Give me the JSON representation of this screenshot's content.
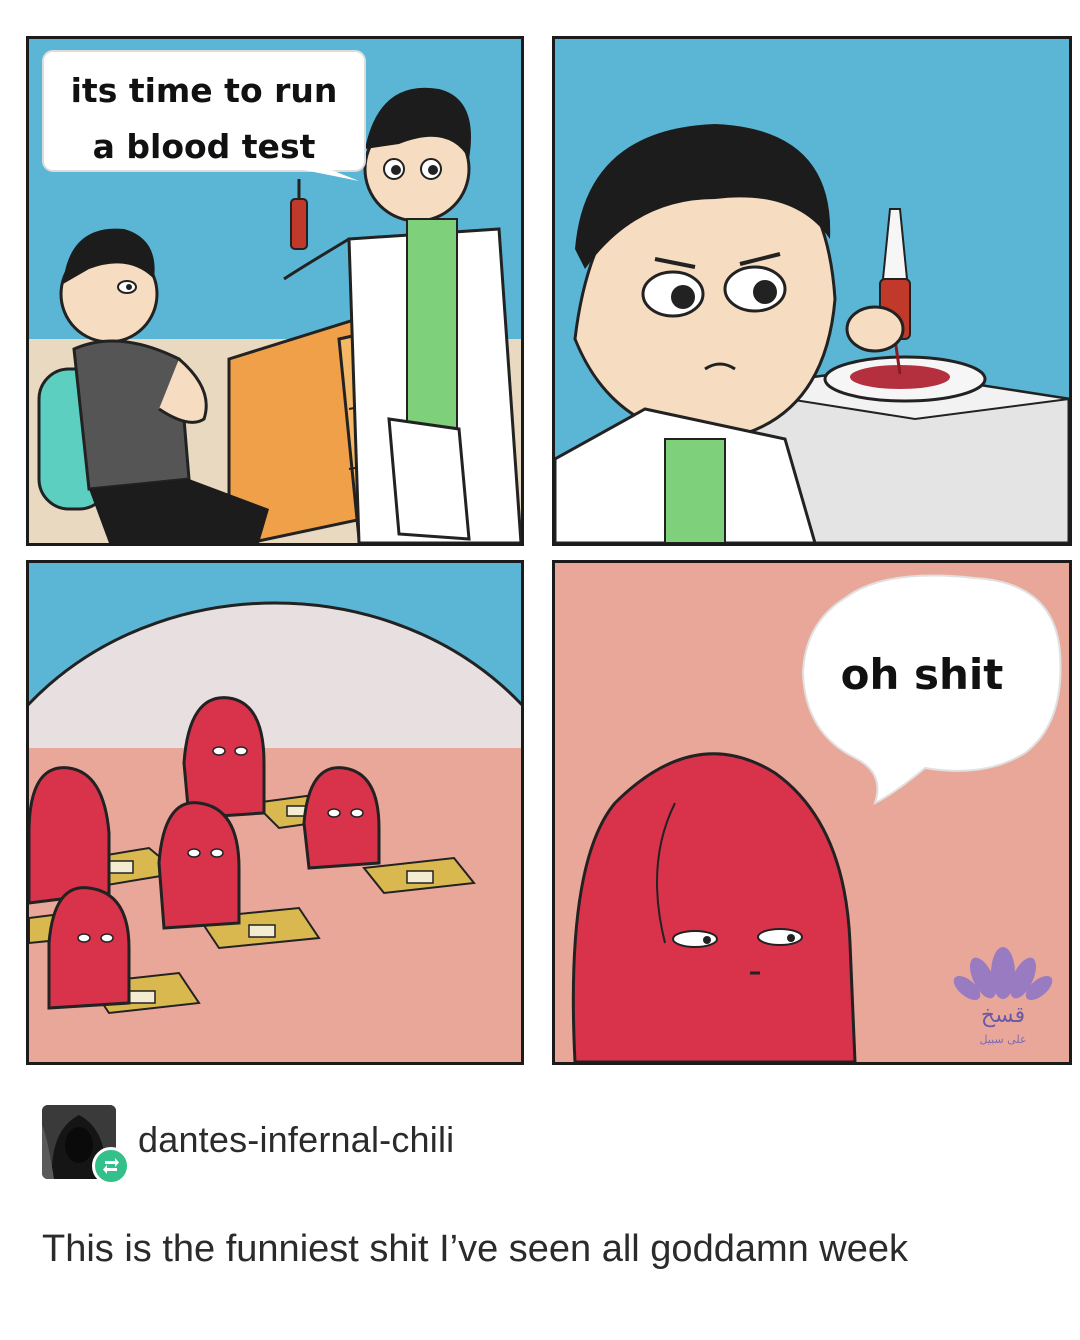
{
  "comic": {
    "panel1": {
      "speech": [
        "its time to run",
        "a blood test"
      ]
    },
    "panel4": {
      "speech": "oh shit"
    },
    "watermark": {
      "main": "قسخ",
      "sub": "ﻋﻠﻰ ﺳﺒﻴﻞ"
    }
  },
  "post": {
    "username": "dantes-infernal-chili",
    "text": "This is the funniest shit I’ve seen all goddamn week",
    "reblog_icon": "reblog-icon",
    "avatar_icon": "avatar-hooded-figure"
  },
  "colors": {
    "sky": "#5bb6d6",
    "blood_cell": "#d8334a",
    "blood_bg": "#e9a79a",
    "cabinet": "#f0a048",
    "lab_coat": "#ffffff",
    "shirt_green": "#7fd07a",
    "reblog_green": "#33c08a"
  }
}
